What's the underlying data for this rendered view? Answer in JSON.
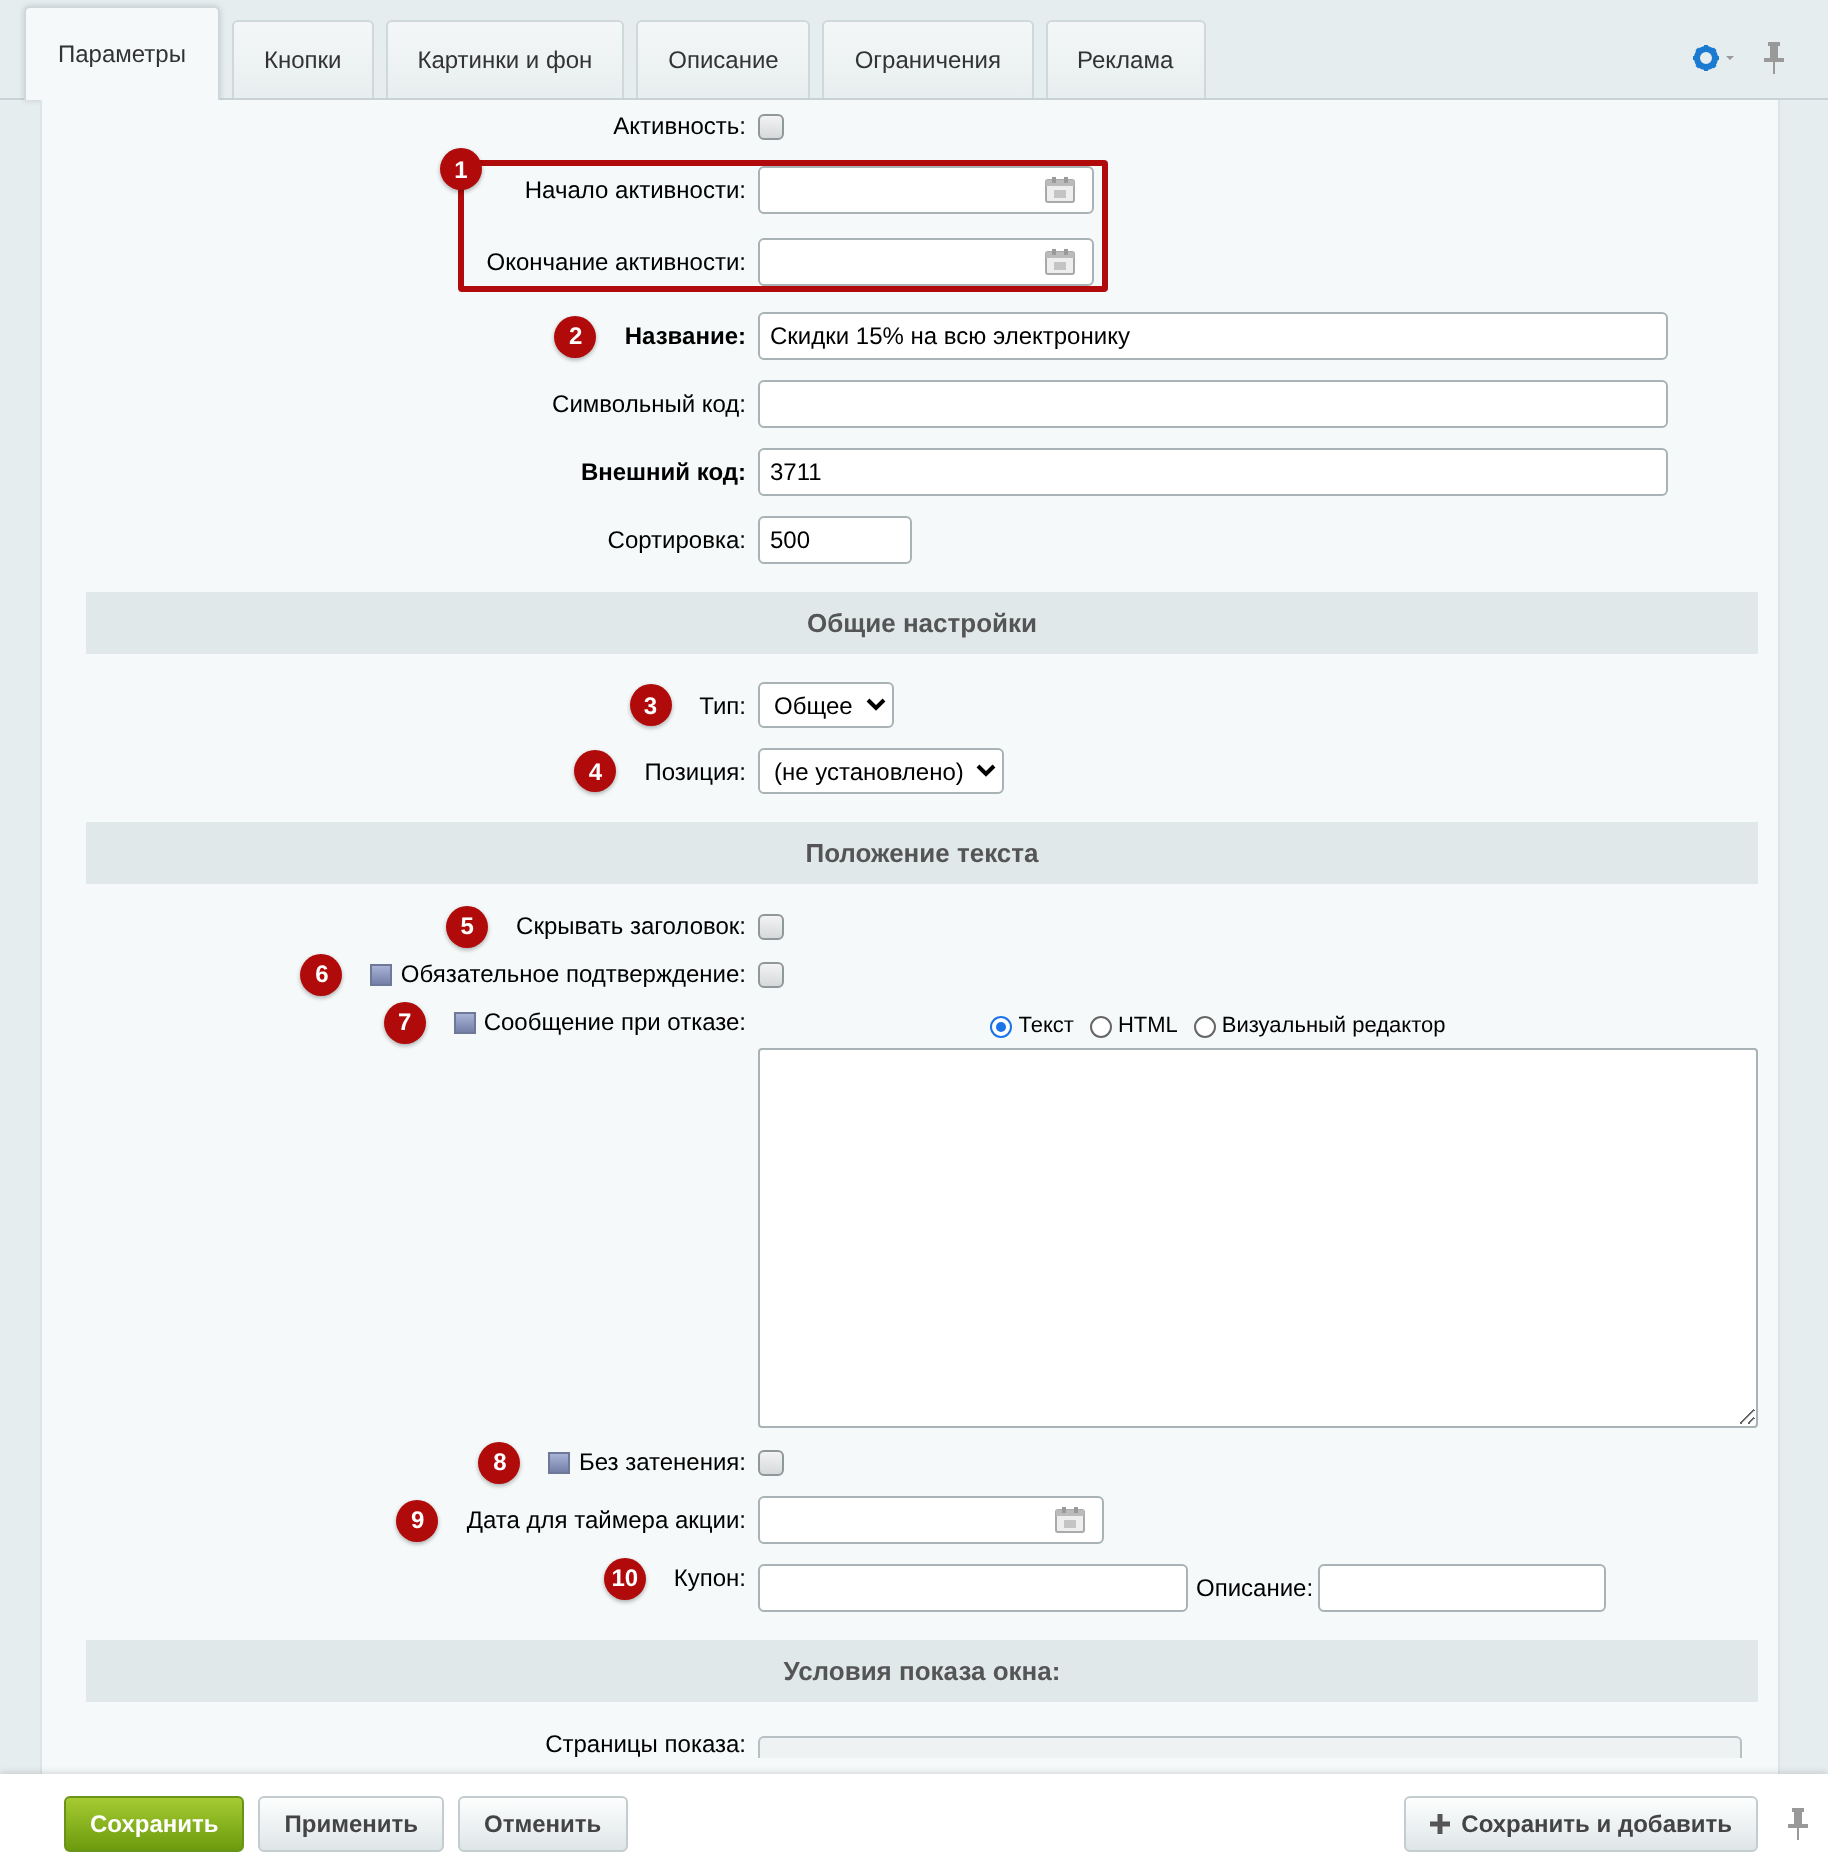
{
  "tabs": [
    {
      "label": "Параметры",
      "selected": true
    },
    {
      "label": "Кнопки",
      "selected": false
    },
    {
      "label": "Картинки и фон",
      "selected": false
    },
    {
      "label": "Описание",
      "selected": false
    },
    {
      "label": "Ограничения",
      "selected": false
    },
    {
      "label": "Реклама",
      "selected": false
    }
  ],
  "fields": [
    {
      "kind": "checkbox",
      "label": "Активность:",
      "checked": false
    },
    {
      "kind": "group",
      "badge": "1",
      "fields": [
        {
          "kind": "date",
          "label": "Начало активности:"
        },
        {
          "kind": "date",
          "label": "Окончание активности:"
        }
      ]
    },
    {
      "kind": "text",
      "badge": "2",
      "label": "Название:",
      "bold": true,
      "value": "Скидки 15% на всю электронику"
    },
    {
      "kind": "text",
      "label": "Символьный код:",
      "bold": false
    },
    {
      "kind": "text",
      "label": "Внешний код:",
      "bold": true,
      "value": "3711"
    },
    {
      "kind": "short",
      "label": "Сортировка:",
      "value": "500"
    },
    {
      "kind": "section",
      "label": "Общие настройки"
    },
    {
      "kind": "select",
      "badge": "3",
      "label": "Тип:",
      "value": "Общее"
    },
    {
      "kind": "select",
      "badge": "4",
      "label": "Позиция:",
      "value": "(не установлено)"
    },
    {
      "kind": "section",
      "label": "Положение текста"
    },
    {
      "kind": "checkbox",
      "badge": "5",
      "label": "Скрывать заголовок:",
      "checked": false
    },
    {
      "kind": "checkbox",
      "badge": "6",
      "help": true,
      "label": "Обязательное подтверждение:",
      "checked": false
    },
    {
      "kind": "editor",
      "badge": "7",
      "help": true,
      "label": "Сообщение при отказе:",
      "options": [
        {
          "label": "Текст",
          "selected": true
        },
        {
          "label": "HTML",
          "selected": false
        },
        {
          "label": "Визуальный редактор",
          "selected": false
        }
      ]
    },
    {
      "kind": "checkbox",
      "badge": "8",
      "help": true,
      "label": "Без затенения:",
      "checked": false
    },
    {
      "kind": "date",
      "badge": "9",
      "label": "Дата для таймера акции:"
    },
    {
      "kind": "coupon",
      "badge": "10",
      "label": "Купон:",
      "second_label": "Описание:"
    },
    {
      "kind": "section",
      "label": "Условия показа окна:"
    },
    {
      "kind": "partial",
      "label": "Страницы показа:"
    }
  ],
  "footer": [
    {
      "kind": "primary",
      "label": "Сохранить"
    },
    {
      "kind": "normal",
      "label": "Применить"
    },
    {
      "kind": "normal",
      "label": "Отменить"
    },
    {
      "kind": "add",
      "label": "Сохранить и добавить"
    }
  ]
}
